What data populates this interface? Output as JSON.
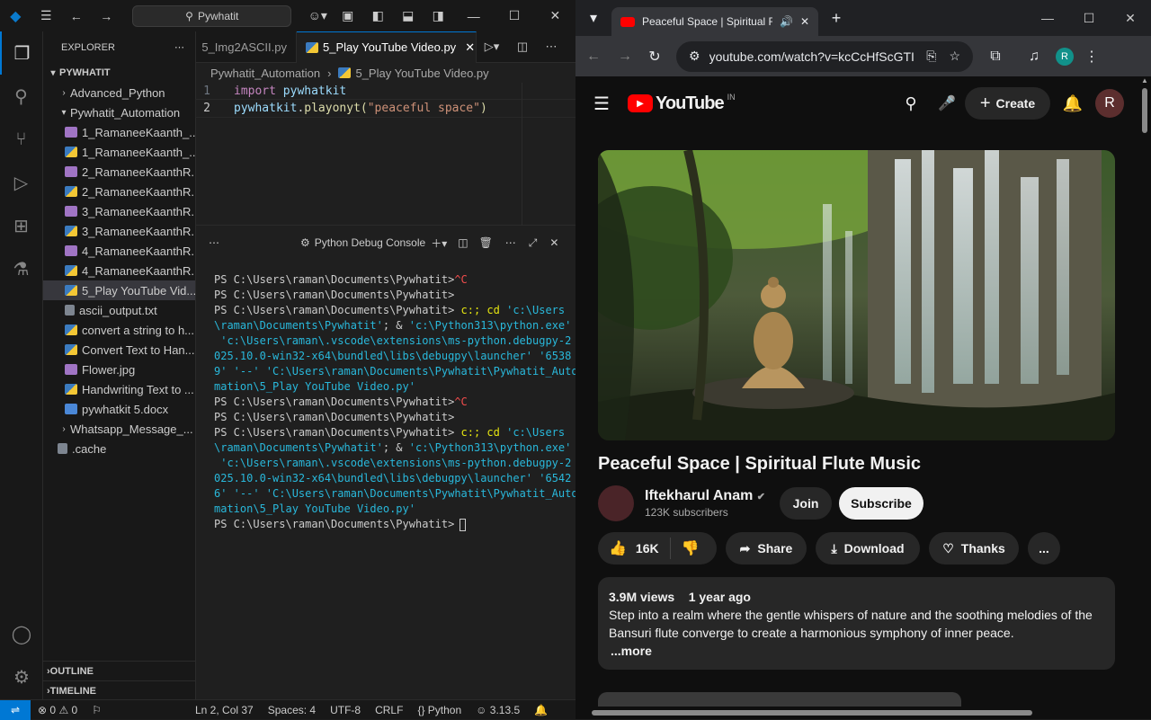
{
  "vscode": {
    "search_text": "Pywhatit",
    "explorer": {
      "title": "EXPLORER",
      "root": "PYWHATIT",
      "items": [
        {
          "label": "Advanced_Python",
          "type": "folder-closed",
          "indent": 1
        },
        {
          "label": "Pywhatit_Automation",
          "type": "folder-open",
          "indent": 1
        },
        {
          "label": "1_RamaneeKaanth_...",
          "type": "img",
          "indent": 2
        },
        {
          "label": "1_RamaneeKaanth_...",
          "type": "py",
          "indent": 2
        },
        {
          "label": "2_RamaneeKaanthR...",
          "type": "img",
          "indent": 2
        },
        {
          "label": "2_RamaneeKaanthR...",
          "type": "py",
          "indent": 2
        },
        {
          "label": "3_RamaneeKaanthR...",
          "type": "img",
          "indent": 2
        },
        {
          "label": "3_RamaneeKaanthR...",
          "type": "py",
          "indent": 2
        },
        {
          "label": "4_RamaneeKaanthR...",
          "type": "img",
          "indent": 2
        },
        {
          "label": "4_RamaneeKaanthR...",
          "type": "py",
          "indent": 2
        },
        {
          "label": "5_Play YouTube Vid...",
          "type": "py",
          "indent": 2,
          "selected": true
        },
        {
          "label": "ascii_output.txt",
          "type": "txt",
          "indent": 2
        },
        {
          "label": "convert a string to h...",
          "type": "py",
          "indent": 2
        },
        {
          "label": "Convert Text to Han...",
          "type": "py",
          "indent": 2
        },
        {
          "label": "Flower.jpg",
          "type": "img",
          "indent": 2
        },
        {
          "label": "Handwriting Text to ...",
          "type": "py",
          "indent": 2
        },
        {
          "label": "pywhatkit 5.docx",
          "type": "doc",
          "indent": 2
        },
        {
          "label": "Whatsapp_Message_...",
          "type": "folder-closed",
          "indent": 1
        },
        {
          "label": ".cache",
          "type": "txt",
          "indent": 1
        }
      ],
      "outline": "OUTLINE",
      "timeline": "TIMELINE"
    },
    "tabs": [
      {
        "label": "5_Img2ASCII.py",
        "active": false
      },
      {
        "label": "5_Play YouTube Video.py",
        "active": true
      }
    ],
    "breadcrumb": {
      "folder": "Pywhatit_Automation",
      "file": "5_Play YouTube Video.py"
    },
    "code": {
      "l1_no": "1",
      "l1_kw": "import",
      "l1_id": "pywhatkit",
      "l2_no": "2",
      "l2_obj": "pywhatkit",
      "l2_dot": ".",
      "l2_fn": "playonyt",
      "l2_open": "(",
      "l2_str": "\"peaceful space\"",
      "l2_close": ")"
    },
    "panel": {
      "title": "Python Debug Console"
    },
    "terminal": {
      "prompt": "PS C:\\Users\\raman\\Documents\\Pywhatit>",
      "ctrl_c": "^C",
      "cmd1": [
        " c:; cd ",
        "'c:\\Users",
        "\\raman\\Documents\\Pywhatit'",
        "; & ",
        "'c:\\Python313\\python.exe'",
        " 'c:\\Users\\raman\\.vscode\\extensions\\ms-python.debugpy-2",
        "025.10.0-win32-x64\\bundled\\libs\\debugpy\\launcher'",
        " '6538",
        "9'",
        " '--'",
        " 'C:\\Users\\raman\\Documents\\Pywhatit\\Pywhatit_Auto",
        "mation\\5_Play YouTube Video.py'"
      ],
      "cmd2": [
        " c:; cd ",
        "'c:\\Users",
        "\\raman\\Documents\\Pywhatit'",
        "; & ",
        "'c:\\Python313\\python.exe'",
        " 'c:\\Users\\raman\\.vscode\\extensions\\ms-python.debugpy-2",
        "025.10.0-win32-x64\\bundled\\libs\\debugpy\\launcher'",
        " '6542",
        "6'",
        " '--'",
        " 'C:\\Users\\raman\\Documents\\Pywhatit\\Pywhatit_Auto",
        "mation\\5_Play YouTube Video.py'"
      ]
    },
    "status": {
      "errors": "0",
      "warnings": "0",
      "position": "Ln 2, Col 37",
      "spaces": "Spaces: 4",
      "encoding": "UTF-8",
      "eol": "CRLF",
      "language": "Python",
      "version": "3.13.5"
    }
  },
  "chrome": {
    "tab_title": "Peaceful Space | Spiritual Flu",
    "url": "youtube.com/watch?v=kcCcHfScGTI",
    "profile_initial": "R"
  },
  "youtube": {
    "logo": "YouTube",
    "region": "IN",
    "create": "Create",
    "avatar": "R",
    "title": "Peaceful Space | Spiritual Flute Music",
    "channel": "Iftekharul Anam",
    "subscribers": "123K subscribers",
    "join": "Join",
    "subscribe": "Subscribe",
    "likes": "16K",
    "share": "Share",
    "download": "Download",
    "thanks": "Thanks",
    "more_dots": "...",
    "views": "3.9M views",
    "age": "1 year ago",
    "description": "Step into a realm where the gentle whispers of nature and the soothing melodies of the Bansuri flute converge to create a harmonious symphony of inner peace.",
    "more": "...more"
  }
}
